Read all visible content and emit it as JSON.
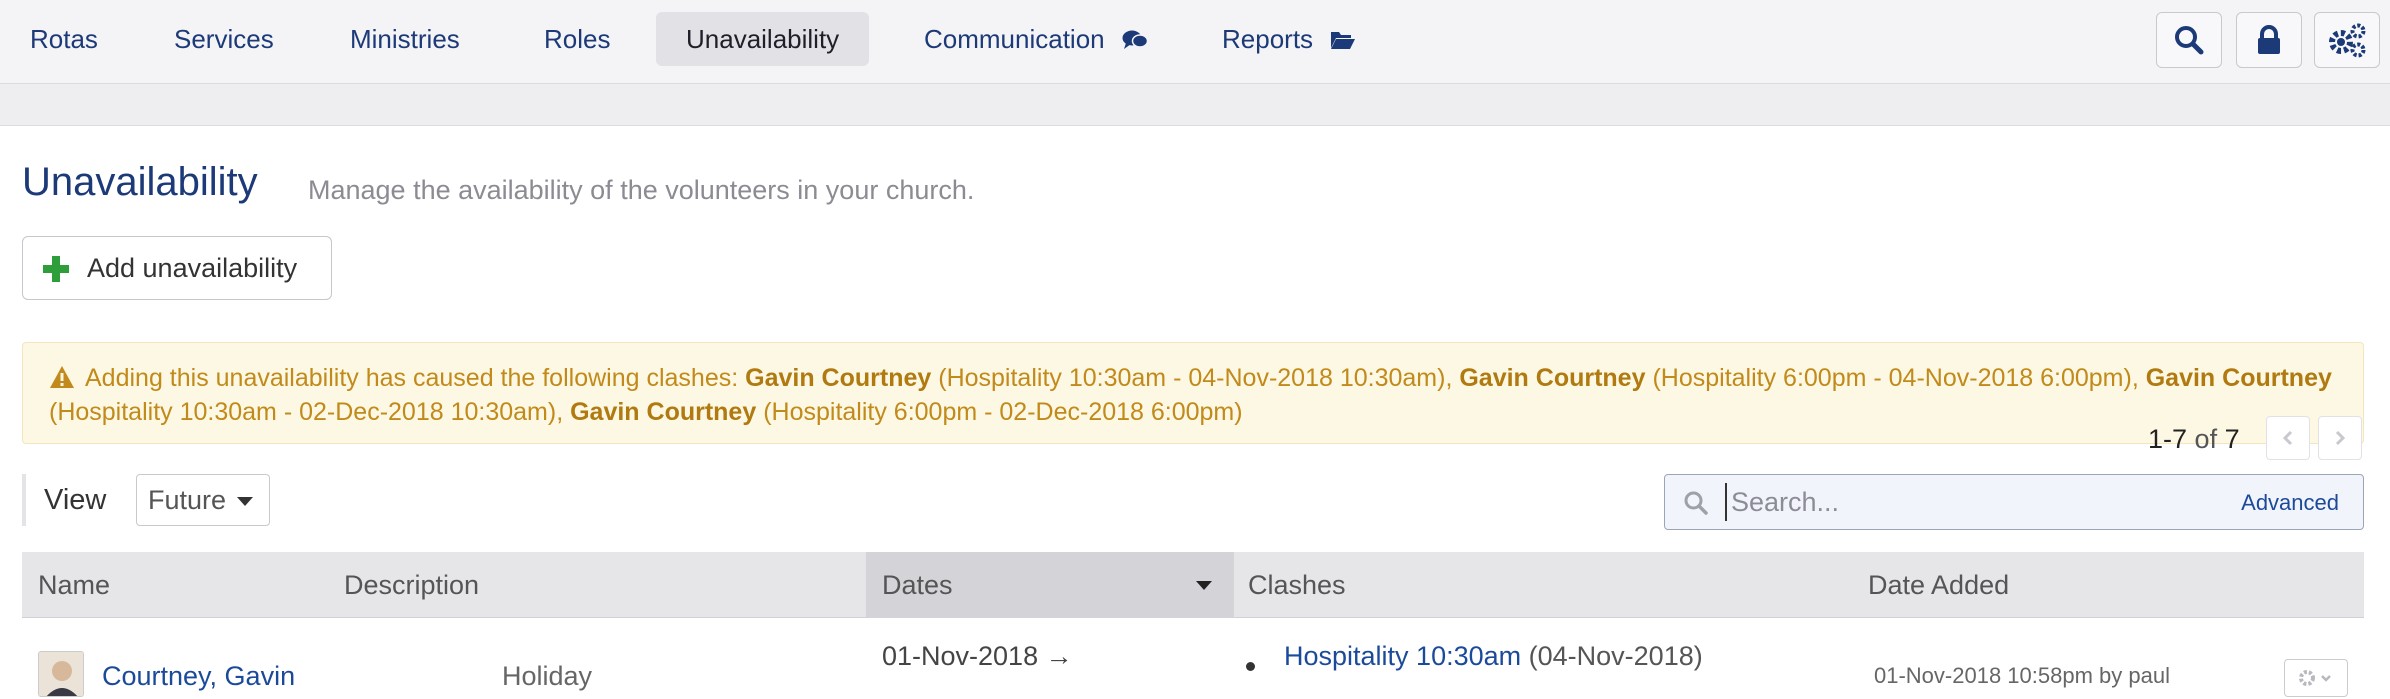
{
  "nav": {
    "items": [
      {
        "label": "Rotas"
      },
      {
        "label": "Services"
      },
      {
        "label": "Ministries"
      },
      {
        "label": "Roles"
      },
      {
        "label": "Unavailability"
      },
      {
        "label": "Communication"
      },
      {
        "label": "Reports"
      }
    ],
    "active": "Unavailability",
    "tools": [
      "search-icon",
      "lock-icon",
      "gears-icon"
    ]
  },
  "page": {
    "title": "Unavailability",
    "subtitle": "Manage the availability of the volunteers in your church.",
    "add_button": "Add unavailability"
  },
  "warning": {
    "intro": "Adding this unavailability has caused the following clashes:",
    "clashes": [
      {
        "person": "Gavin Courtney",
        "detail": "(Hospitality 10:30am - 04-Nov-2018 10:30am),"
      },
      {
        "person": "Gavin Courtney",
        "detail": "(Hospitality 6:00pm - 04-Nov-2018 6:00pm),"
      },
      {
        "person": "Gavin Courtney",
        "detail": "(Hospitality 10:30am - 02-Dec-2018 10:30am),"
      },
      {
        "person": "Gavin Courtney",
        "detail": "(Hospitality 6:00pm - 02-Dec-2018 6:00pm)"
      }
    ]
  },
  "pager": {
    "range": "1-7",
    "of": "of",
    "total": "7"
  },
  "view": {
    "label": "View",
    "selected": "Future"
  },
  "search": {
    "placeholder": "Search...",
    "advanced": "Advanced"
  },
  "table": {
    "columns": [
      "Name",
      "Description",
      "Dates",
      "Clashes",
      "Date Added"
    ],
    "sorted_column": "Dates",
    "rows": [
      {
        "name": "Courtney, Gavin",
        "description": "Holiday",
        "dates": "01-Nov-2018 →",
        "clash_link": "Hospitality 10:30am",
        "clash_date": "(04-Nov-2018)",
        "date_added": "01-Nov-2018 10:58pm by paul"
      }
    ]
  },
  "colors": {
    "brand": "#1c3a78",
    "warning_text": "#c18a1a",
    "warning_bg": "#fcf8e3",
    "add_icon": "#2e9e3a"
  }
}
